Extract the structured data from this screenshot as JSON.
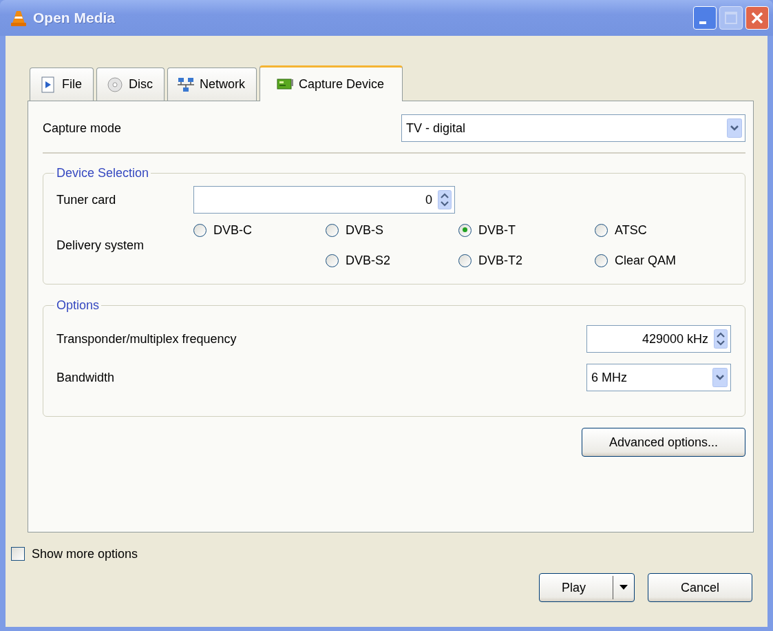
{
  "window": {
    "title": "Open Media"
  },
  "tabs": [
    {
      "label": "File",
      "selected": false
    },
    {
      "label": "Disc",
      "selected": false
    },
    {
      "label": "Network",
      "selected": false
    },
    {
      "label": "Capture Device",
      "selected": true
    }
  ],
  "capture_mode": {
    "label": "Capture mode",
    "value": "TV - digital"
  },
  "device_selection": {
    "title": "Device Selection",
    "tuner_card": {
      "label": "Tuner card",
      "value": "0"
    },
    "delivery_system": {
      "label": "Delivery system",
      "rows": [
        [
          {
            "label": "DVB-C",
            "selected": false
          },
          {
            "label": "DVB-S",
            "selected": false
          },
          {
            "label": "DVB-T",
            "selected": true
          },
          {
            "label": "ATSC",
            "selected": false
          }
        ],
        [
          "",
          {
            "label": "DVB-S2",
            "selected": false
          },
          {
            "label": "DVB-T2",
            "selected": false
          },
          {
            "label": "Clear QAM",
            "selected": false
          }
        ]
      ]
    }
  },
  "options": {
    "title": "Options",
    "frequency": {
      "label": "Transponder/multiplex frequency",
      "value": "429000 kHz"
    },
    "bandwidth": {
      "label": "Bandwidth",
      "value": "6 MHz"
    }
  },
  "advanced_button": "Advanced options...",
  "show_more": {
    "label": "Show more options",
    "checked": false
  },
  "buttons": {
    "play": "Play",
    "cancel": "Cancel"
  }
}
